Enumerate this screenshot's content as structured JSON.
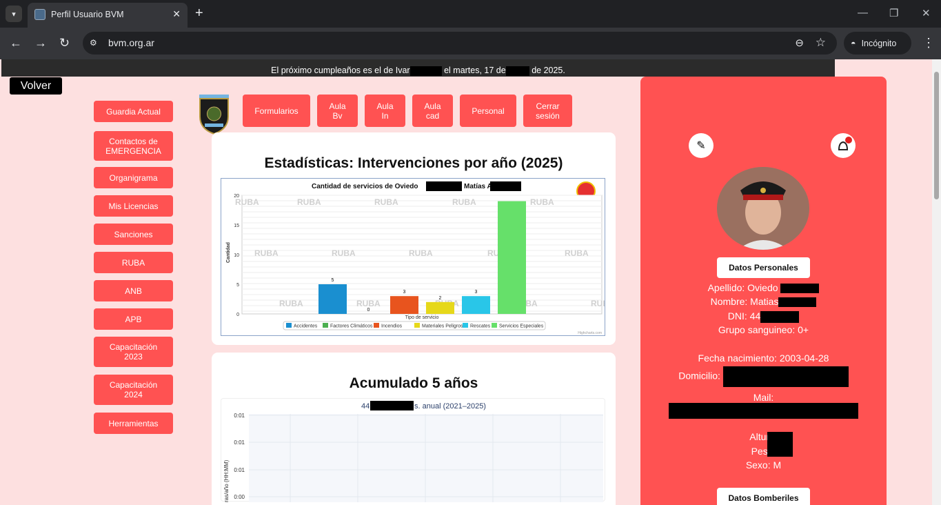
{
  "browser": {
    "tab_title": "Perfil Usuario BVM",
    "url": "bvm.org.ar",
    "incognito_label": "Incógnito"
  },
  "announcement": {
    "part1": "El próximo cumpleaños es el de Ivar",
    "part2": "el martes, 17 de",
    "part3": "de 2025."
  },
  "volver_label": "Volver",
  "sidebar": {
    "items": [
      {
        "label": "Guardia Actual"
      },
      {
        "label": "Contactos de EMERGENCIA"
      },
      {
        "label": "Organigrama"
      },
      {
        "label": "Mis Licencias"
      },
      {
        "label": "Sanciones"
      },
      {
        "label": "RUBA"
      },
      {
        "label": "ANB"
      },
      {
        "label": "APB"
      },
      {
        "label": "Capacitación 2023"
      },
      {
        "label": "Capacitación 2024"
      },
      {
        "label": "Herramientas"
      }
    ]
  },
  "topnav": {
    "items": [
      {
        "label": "Formularios"
      },
      {
        "label": "Aula Bv"
      },
      {
        "label": "Aula In"
      },
      {
        "label": "Aula cad"
      },
      {
        "label": "Personal"
      },
      {
        "label": "Cerrar sesión"
      }
    ]
  },
  "stats_card": {
    "heading": "Estadísticas: Intervenciones por año (2025)"
  },
  "accum_card": {
    "heading": "Acumulado 5 años",
    "chart_title_prefix": "44",
    "chart_title_suffix": "s. anual (2021–2025)",
    "ylabel": "ras/año (HH:MM)",
    "yticks": [
      "0:01",
      "0:01",
      "0:01",
      "0:00"
    ]
  },
  "chart_data": [
    {
      "type": "bar",
      "title": "Cantidad de servicios de Oviedo",
      "title_suffix": "Matías A",
      "xlabel": "Tipo de servicio",
      "ylabel": "Cantidad",
      "ylim": [
        0,
        20
      ],
      "yticks": [
        0,
        5,
        10,
        15,
        20
      ],
      "watermark": "RUBA",
      "credit": "Highcharts.com",
      "series": [
        {
          "name": "Accidentes",
          "value": 5,
          "color": "#1a8fd0"
        },
        {
          "name": "Factores Climáticos",
          "value": 0,
          "color": "#4caf50"
        },
        {
          "name": "Incendios",
          "value": 3,
          "color": "#e8541e"
        },
        {
          "name": "Materiales Peligrosos",
          "value": 2,
          "color": "#e6d81a"
        },
        {
          "name": "Rescates",
          "value": 3,
          "color": "#29c6e8"
        },
        {
          "name": "Servicios Especiales",
          "value": 19,
          "color": "#66e06a"
        }
      ],
      "legend_position": "bottom"
    }
  ],
  "profile": {
    "datos_personales_label": "Datos Personales",
    "apellido_label": "Apellido: Oviedo",
    "nombre_label": "Nombre: Matias",
    "dni_label": "DNI: 44",
    "grupo": "Grupo sanguineo: 0+",
    "fecha": "Fecha nacimiento: 2003-04-28",
    "domicilio_label": "Domicilio:",
    "mail_label": "Mail:",
    "altura_label": "Altura:",
    "peso_label": "Peso:",
    "sexo": "Sexo: M",
    "datos_bomberiles_label": "Datos Bomberiles"
  }
}
